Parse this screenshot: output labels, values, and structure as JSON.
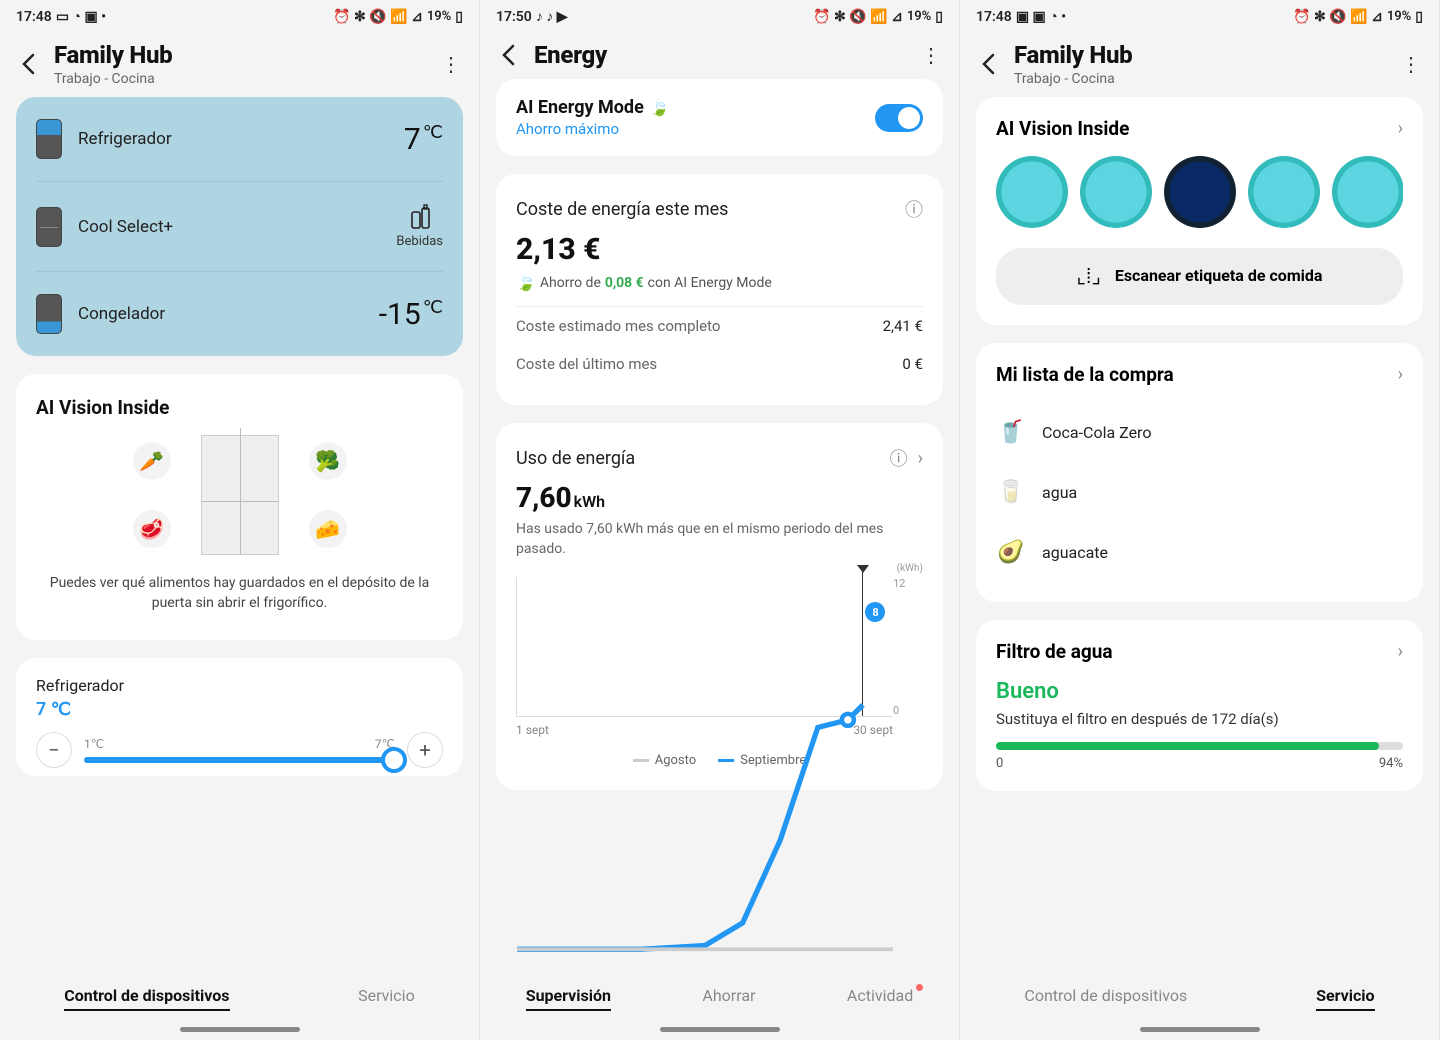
{
  "s1": {
    "status": {
      "time": "17:48",
      "battery": "19%"
    },
    "header": {
      "title": "Family Hub",
      "subtitle": "Trabajo - Cocina"
    },
    "temps": {
      "ref_label": "Refrigerador",
      "ref_val": "7",
      "ref_unit": "℃",
      "cs_label": "Cool Select+",
      "cs_mode": "Bebidas",
      "frz_label": "Congelador",
      "frz_val": "-15",
      "frz_unit": "℃"
    },
    "ai": {
      "title": "AI Vision Inside",
      "desc": "Puedes ver qué alimentos hay guardados en el depósito de la puerta sin abrir el frigorífico."
    },
    "ctrl": {
      "name": "Refrigerador",
      "value": "7 ℃",
      "min": "1℃",
      "max": "7℃"
    },
    "tabs": {
      "t1": "Control de dispositivos",
      "t2": "Servicio"
    }
  },
  "s2": {
    "status": {
      "time": "17:50",
      "battery": "19%"
    },
    "header": {
      "title": "Energy"
    },
    "aimode": {
      "title": "AI Energy Mode",
      "sub": "Ahorro máximo"
    },
    "cost": {
      "title": "Coste de energía este mes",
      "value": "2,13 €",
      "saving_pre": "Ahorro de ",
      "saving_amt": "0,08 €",
      "saving_post": " con AI Energy Mode",
      "l1": "Coste estimado mes completo",
      "v1": "2,41 €",
      "l2": "Coste del último mes",
      "v2": "0 €"
    },
    "usage": {
      "title": "Uso de energía",
      "value": "7,60",
      "unit": "kWh",
      "desc": "Has usado 7,60 kWh más que en el mismo periodo del mes pasado.",
      "ymax": "12",
      "ymin": "0",
      "yunit": "(kWh)",
      "x1": "1 sept",
      "x2": "30 sept",
      "legend_a": "Agosto",
      "legend_b": "Septiembre",
      "badge": "8"
    },
    "tabs": {
      "t1": "Supervisión",
      "t2": "Ahorrar",
      "t3": "Actividad"
    }
  },
  "s3": {
    "status": {
      "time": "17:48",
      "battery": "19%"
    },
    "header": {
      "title": "Family Hub",
      "subtitle": "Trabajo - Cocina"
    },
    "av": {
      "title": "AI Vision Inside",
      "scan": "Escanear etiqueta de comida"
    },
    "list": {
      "title": "Mi lista de la compra",
      "i1": "Coca-Cola Zero",
      "i2": "agua",
      "i3": "aguacate"
    },
    "filter": {
      "title": "Filtro de agua",
      "status": "Bueno",
      "desc": "Sustituya el filtro en después de 172 día(s)",
      "min": "0",
      "pct": "94%",
      "pct_num": 94
    },
    "tabs": {
      "t1": "Control de dispositivos",
      "t2": "Servicio"
    }
  },
  "chart_data": {
    "type": "line",
    "title": "Uso de energía",
    "xlabel": "",
    "ylabel": "kWh",
    "ylim": [
      0,
      12
    ],
    "x_range": [
      "1 sept",
      "30 sept"
    ],
    "series": [
      {
        "name": "Agosto",
        "color": "#bbb",
        "values_note": "flat near 0 across period"
      },
      {
        "name": "Septiembre",
        "color": "#2296f3",
        "x": [
          1,
          10,
          15,
          20,
          23,
          26,
          27,
          28
        ],
        "y": [
          0,
          0,
          0.2,
          1,
          4,
          7.5,
          7.6,
          8
        ]
      }
    ],
    "annotations": [
      {
        "x": 28,
        "y": 8,
        "label": "8"
      }
    ]
  }
}
